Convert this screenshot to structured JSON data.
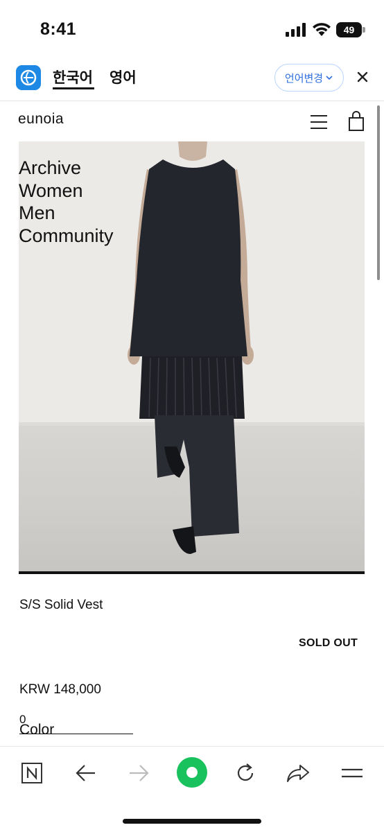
{
  "status_bar": {
    "time": "8:41",
    "battery": "49"
  },
  "translator": {
    "active_language": "한국어",
    "other_language": "영어",
    "change_language_label": "언어변경"
  },
  "site": {
    "logo": "eunoia",
    "nav": [
      "Archive",
      "Women",
      "Men",
      "Community"
    ]
  },
  "product": {
    "name": "S/S Solid Vest",
    "status": "SOLD OUT",
    "price": "KRW 148,000",
    "option_label": "Color",
    "option_counter": "0"
  },
  "colors": {
    "accent_blue": "#2f6fdf",
    "logo_blue": "#1e88e5",
    "reload_green": "#19c25d"
  }
}
